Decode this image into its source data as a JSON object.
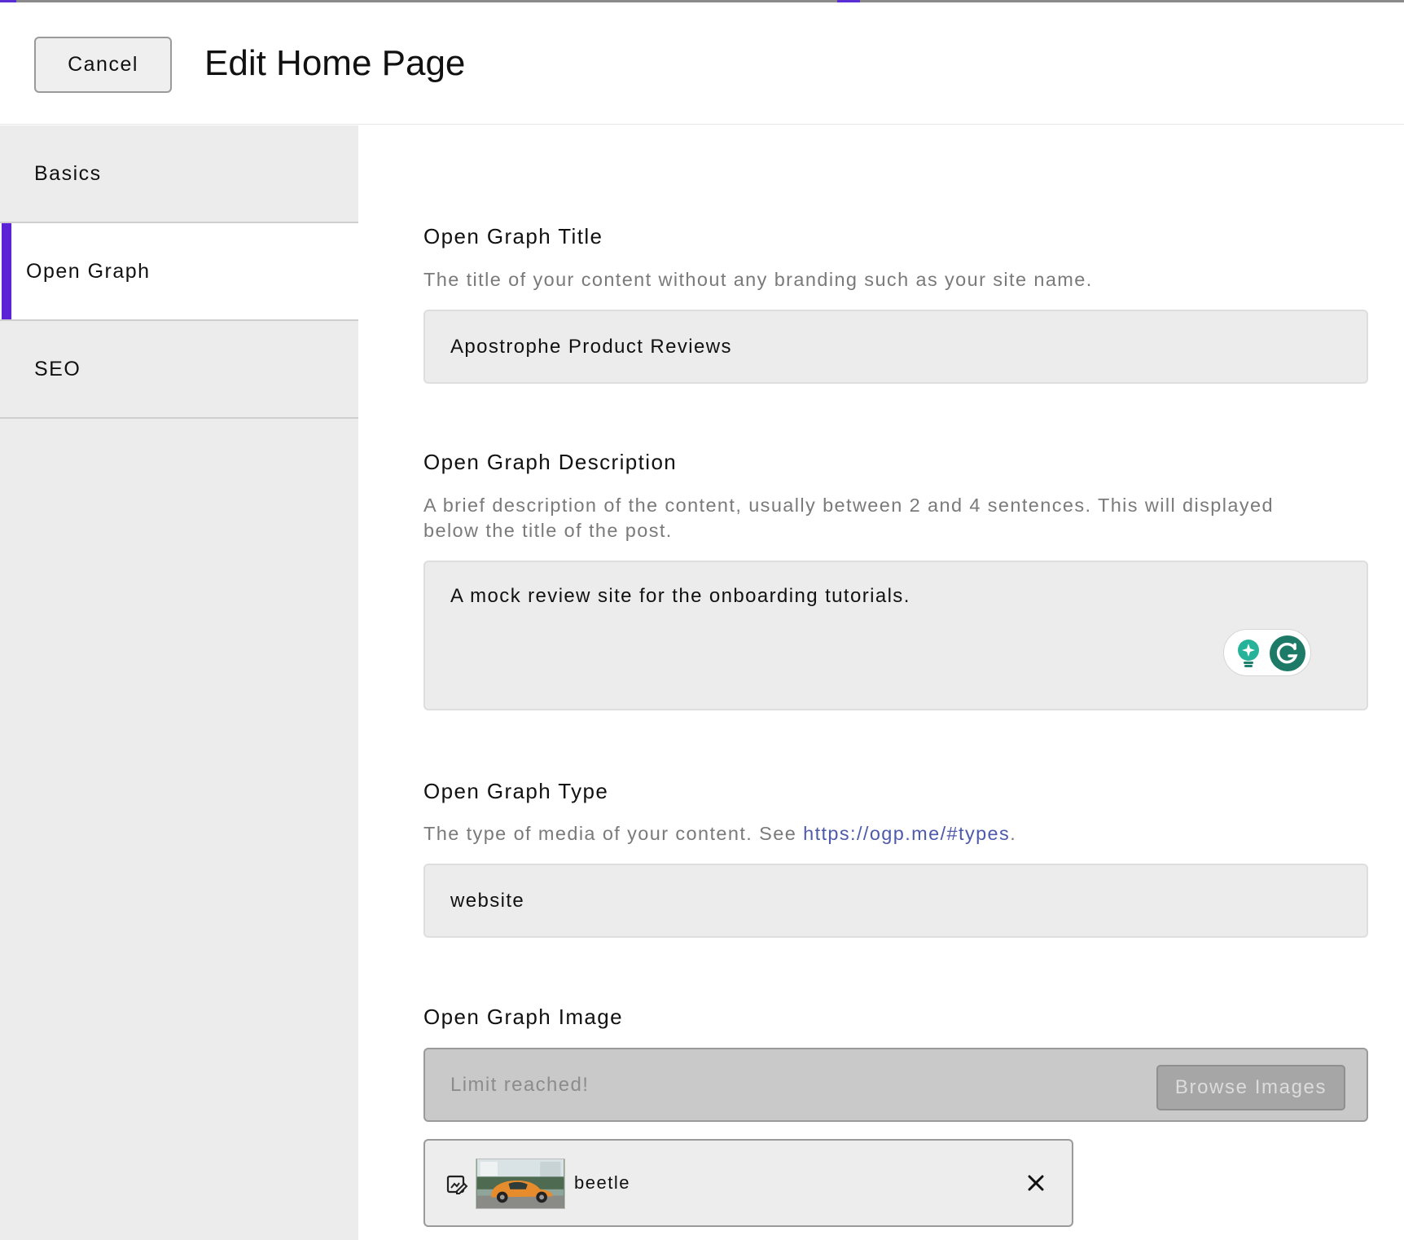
{
  "header": {
    "cancel_label": "Cancel",
    "title": "Edit Home Page"
  },
  "sidebar": {
    "items": [
      {
        "label": "Basics",
        "active": false
      },
      {
        "label": "Open Graph",
        "active": true
      },
      {
        "label": "SEO",
        "active": false
      }
    ]
  },
  "fields": {
    "og_title": {
      "label": "Open Graph Title",
      "help": "The title of your content without any branding such as your site name.",
      "value": "Apostrophe Product Reviews"
    },
    "og_description": {
      "label": "Open Graph Description",
      "help_line1": "A brief description of the content, usually between 2 and 4 sentences. This will displayed",
      "help_line2": "below the title of the post.",
      "value": "A mock review site for the onboarding tutorials."
    },
    "og_type": {
      "label": "Open Graph Type",
      "help_prefix": "The type of media of your content. See ",
      "help_link": "https://ogp.me/#types",
      "help_suffix": ".",
      "value": "website"
    },
    "og_image": {
      "label": "Open Graph Image",
      "placeholder": "Limit reached!",
      "browse_label": "Browse Images",
      "attachment_name": "beetle"
    }
  },
  "icons": {
    "grammarly_bulb": "lightbulb-icon",
    "grammarly_g": "grammarly-icon",
    "edit": "edit-image-icon",
    "remove": "close-icon"
  },
  "colors": {
    "accent": "#5b22d6",
    "link": "#4f5aaa",
    "grammarly": "#15a38b"
  }
}
